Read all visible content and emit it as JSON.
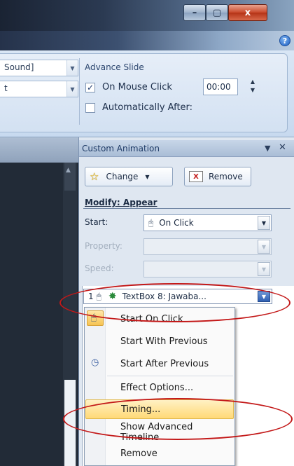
{
  "window": {
    "minimize_glyph": "–",
    "maximize_glyph": "▢",
    "close_glyph": "x",
    "help_glyph": "?"
  },
  "ribbon": {
    "sound_combo": "Sound]",
    "second_combo": "t",
    "advance_title": "Advance Slide",
    "on_mouse_click": "On Mouse Click",
    "on_mouse_click_checked": true,
    "auto_after": "Automatically After:",
    "auto_after_checked": false,
    "auto_time": "00:00"
  },
  "pane": {
    "title": "Custom Animation",
    "change_label": "Change",
    "remove_label": "Remove",
    "modify_title": "Modify: Appear",
    "start_label": "Start:",
    "start_value": "On Click",
    "property_label": "Property:",
    "speed_label": "Speed:",
    "list_item": {
      "index": "1",
      "text": "TextBox 8: Jawaba..."
    }
  },
  "menu": {
    "items": [
      {
        "label": "Start On Click"
      },
      {
        "label": "Start With Previous"
      },
      {
        "label": "Start After Previous"
      },
      {
        "label": "Effect Options..."
      },
      {
        "label": "Timing..."
      },
      {
        "label": "Show Advanced Timeline"
      },
      {
        "label": "Remove"
      }
    ]
  },
  "colors": {
    "highlight": "#ffd977",
    "annotation": "#c31818",
    "pane_bg": "#dfe7f1"
  },
  "icons": [
    "minimize-icon",
    "maximize-icon",
    "close-icon",
    "help-icon",
    "star-icon",
    "remove-x-icon",
    "mouse-icon",
    "green-star-icon",
    "clock-icon"
  ]
}
